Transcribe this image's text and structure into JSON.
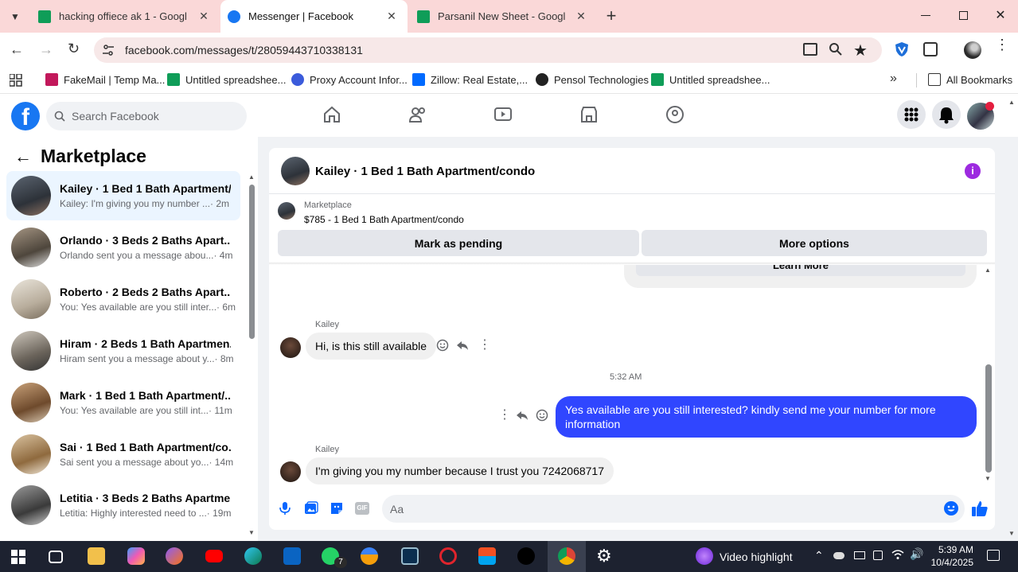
{
  "browser": {
    "tabs": [
      {
        "title": "hacking offiece ak 1 - Google S",
        "active": false
      },
      {
        "title": "Messenger | Facebook",
        "active": true
      },
      {
        "title": "Parsanil New Sheet - Google Sh",
        "active": false
      }
    ],
    "url": "facebook.com/messages/t/28059443710338131",
    "bookmarks": [
      "FakeMail | Temp Ma...",
      "Untitled spreadshee...",
      "Proxy Account Infor...",
      "Zillow: Real Estate,...",
      "Pensol Technologies",
      "Untitled spreadshee..."
    ],
    "all_bookmarks": "All Bookmarks"
  },
  "facebook": {
    "search_placeholder": "Search Facebook"
  },
  "sidebar": {
    "title": "Marketplace",
    "conversations": [
      {
        "name": "Kailey · 1 Bed 1 Bath Apartment/...",
        "preview": "Kailey: I'm giving you my number ...",
        "time": "· 2m"
      },
      {
        "name": "Orlando · 3 Beds 2 Baths Apart...",
        "preview": "Orlando sent you a message abou...",
        "time": "· 4m"
      },
      {
        "name": "Roberto · 2 Beds 2 Baths Apart...",
        "preview": "You: Yes available are you still inter...",
        "time": "· 6m"
      },
      {
        "name": "Hiram · 2 Beds 1 Bath Apartmen...",
        "preview": "Hiram sent you a message about y...",
        "time": "· 8m"
      },
      {
        "name": "Mark · 1 Bed 1 Bath Apartment/...",
        "preview": "You: Yes available are you still int...",
        "time": "· 11m"
      },
      {
        "name": "Sai · 1 Bed 1 Bath Apartment/co...",
        "preview": "Sai sent you a message about yo...",
        "time": "· 14m"
      },
      {
        "name": "Letitia · 3 Beds 2 Baths Apartme...",
        "preview": "Letitia: Highly interested need to ...",
        "time": "· 19m"
      }
    ]
  },
  "chat": {
    "header_title": "Kailey · 1 Bed 1 Bath Apartment/condo",
    "listing_source": "Marketplace",
    "listing_title": "$785 - 1 Bed 1 Bath Apartment/condo",
    "mark_pending": "Mark as pending",
    "more_options": "More options",
    "learn_more": "Learn More",
    "messages": [
      {
        "sender": "Kailey",
        "text": "Hi, is this still available"
      },
      {
        "timestamp": "5:32 AM"
      },
      {
        "sender": "You",
        "text": "Yes available are you still interested? kindly send me your number for more information"
      },
      {
        "sender": "Kailey",
        "text": "I'm giving you my number because I trust you 7242068717"
      }
    ],
    "composer_placeholder": "Aa"
  },
  "taskbar": {
    "whatsapp_badge": "7",
    "notification_text": "Video highlight",
    "time": "5:39 AM",
    "date": "10/4/2025"
  },
  "colors": {
    "fb_blue": "#1877f2",
    "outgoing_bubble": "#3046ff",
    "tabbar_bg": "#fad8d8"
  }
}
